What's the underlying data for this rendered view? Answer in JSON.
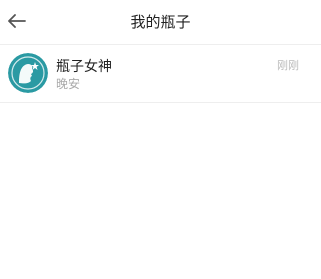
{
  "header": {
    "title": "我的瓶子",
    "back_icon": "arrow-left-icon"
  },
  "conversations": [
    {
      "name": "瓶子女神",
      "preview": "晚安",
      "time": "刚刚",
      "avatar_color": "#2a9aa3",
      "avatar_icon": "silhouette-with-star-avatar"
    }
  ],
  "colors": {
    "accent": "#2a9aa3",
    "divider": "#eeeeee"
  }
}
